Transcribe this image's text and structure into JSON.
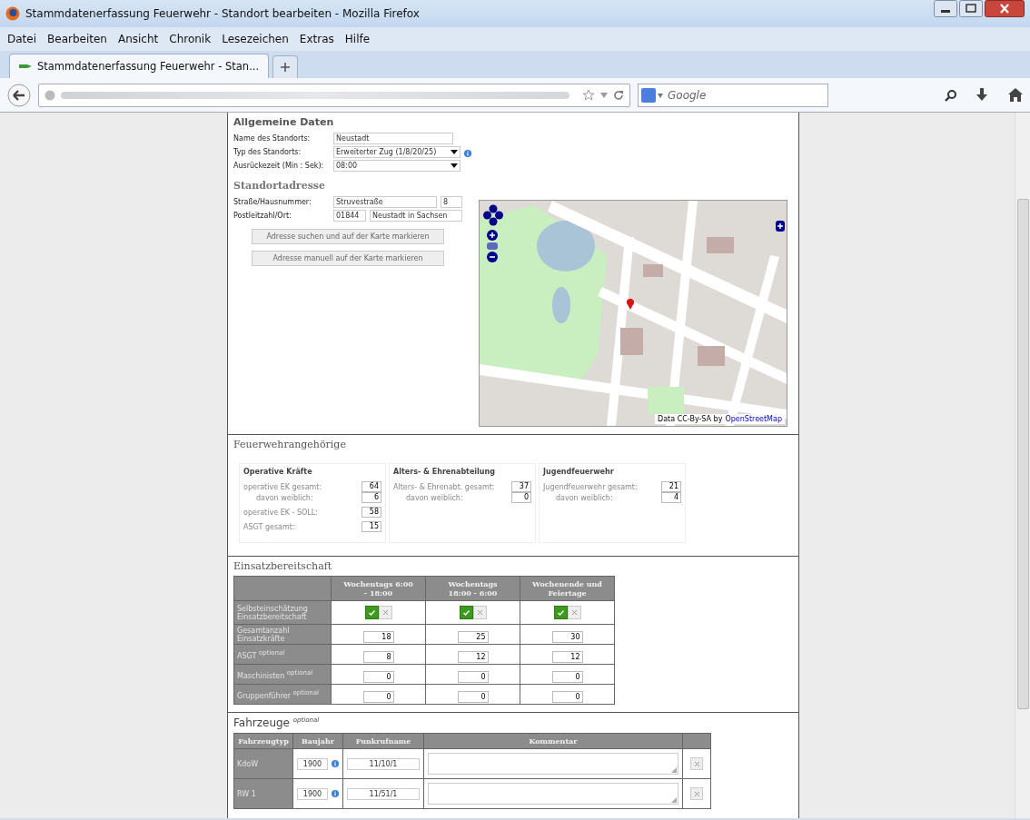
{
  "window": {
    "title": "Stammdatenerfassung Feuerwehr - Standort bearbeiten - Mozilla Firefox"
  },
  "menu": [
    {
      "label": "Datei"
    },
    {
      "label": "Bearbeiten"
    },
    {
      "label": "Ansicht"
    },
    {
      "label": "Chronik"
    },
    {
      "label": "Lesezeichen"
    },
    {
      "label": "Extras"
    },
    {
      "label": "Hilfe"
    }
  ],
  "tabs": [
    {
      "label": "Stammdatenerfassung Feuerwehr - Stan...",
      "selected": true
    }
  ],
  "search": {
    "placeholder": "Google"
  },
  "general": {
    "heading": "Allgemeine Daten",
    "fields": [
      {
        "label": "Name des Standorts:",
        "kind": "text",
        "value": "Neustadt",
        "info": false
      },
      {
        "label": "Typ des Standorts:",
        "kind": "select",
        "value": "Erweiterter Zug (1/8/20/25)",
        "info": true
      },
      {
        "label": "Ausrückezeit (Min : Sek):",
        "kind": "select",
        "value": "08:00",
        "info": false
      }
    ]
  },
  "address": {
    "heading": "Standortadresse",
    "rows": [
      {
        "label": "Straße/Hausnummer:",
        "kind": "wide-narrow",
        "values": [
          "Struvestraße",
          "8"
        ]
      },
      {
        "label": "Postleitzahl/Ort:",
        "kind": "narrow-wide",
        "values": [
          "01844",
          "Neustadt in Sachsen"
        ]
      }
    ],
    "buttons": [
      "Adresse suchen und auf der Karte markieren",
      "Adresse manuell auf der Karte markieren"
    ]
  },
  "map": {
    "kind": "picture",
    "attribution": "Data CC-By-SA by",
    "attribution_link": "OpenStreetMap"
  },
  "personnel": {
    "heading": "Feuerwehrangehörige",
    "groups": [
      {
        "title": "Operative Kräfte",
        "rows": [
          {
            "label": "operative EK gesamt:",
            "kind": "main",
            "value": "64"
          },
          {
            "label": "davon weiblich:",
            "kind": "sub",
            "value": "6"
          },
          {
            "label": "operative EK - SOLL:",
            "kind": "main",
            "value": "58"
          },
          {
            "label": "ASGT gesamt:",
            "kind": "main",
            "value": "15"
          }
        ]
      },
      {
        "title": "Alters- & Ehrenabteilung",
        "rows": [
          {
            "label": "Alters- & Ehrenabt. gesamt:",
            "kind": "main",
            "value": "37"
          },
          {
            "label": "davon weiblich:",
            "kind": "sub",
            "value": "0"
          }
        ]
      },
      {
        "title": "Jugendfeuerwehr",
        "rows": [
          {
            "label": "Jugendfeuerwehr gesamt:",
            "kind": "main",
            "value": "21"
          },
          {
            "label": "davon weiblich:",
            "kind": "sub",
            "value": "4"
          }
        ]
      }
    ]
  },
  "readiness": {
    "heading": "Einsatzbereitschaft",
    "columns": [
      "Wochentags 6:00 - 18:00",
      "Wochentags 18:00 - 6:00",
      "Wochenende und Feiertage"
    ],
    "rows": [
      {
        "label": "Selbsteinschätzung Einsatzbereitschaft",
        "kind": "toggle",
        "cells": [
          {
            "selected": true
          },
          {
            "selected": true
          },
          {
            "selected": true
          }
        ]
      },
      {
        "label": "Gesamtanzahl Einsatzkräfte",
        "kind": "number",
        "cells": [
          "18",
          "25",
          "30"
        ]
      },
      {
        "label": "ASGT",
        "note": "optional",
        "kind": "number",
        "cells": [
          "8",
          "12",
          "12"
        ]
      },
      {
        "label": "Maschinisten",
        "note": "optional",
        "kind": "number",
        "cells": [
          "0",
          "0",
          "0"
        ]
      },
      {
        "label": "Gruppenführer",
        "note": "optional",
        "kind": "number",
        "cells": [
          "0",
          "0",
          "0"
        ]
      }
    ]
  },
  "vehicles": {
    "heading": "Fahrzeuge",
    "note": "optional",
    "columns": [
      "Fahrzeugtyp",
      "Baujahr",
      "Funkrufname",
      "Kommentar"
    ],
    "rows": [
      {
        "type": "KdoW",
        "year": "1900",
        "callsign": "11/10/1"
      },
      {
        "type": "RW 1",
        "year": "1900",
        "callsign": "11/51/1"
      }
    ]
  }
}
